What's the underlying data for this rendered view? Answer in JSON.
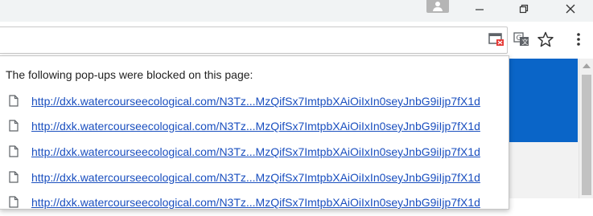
{
  "window": {
    "title": "",
    "controls": {
      "minimize": "–",
      "restore": "❐",
      "close": "✕"
    }
  },
  "toolbar": {
    "icons": [
      "popup-blocked-icon",
      "translate-icon",
      "star-icon",
      "menu-icon"
    ]
  },
  "popup_bubble": {
    "title": "The following pop-ups were blocked on this page:",
    "links": [
      "http://dxk.watercourseecological.com/N3Tz...MzQifSx7ImtpbXAiOiIxIn0seyJnbG9iIjp7fX1d",
      "http://dxk.watercourseecological.com/N3Tz...MzQifSx7ImtpbXAiOiIxIn0seyJnbG9iIjp7fX1d",
      "http://dxk.watercourseecological.com/N3Tz...MzQifSx7ImtpbXAiOiIxIn0seyJnbG9iIjp7fX1d",
      "http://dxk.watercourseecological.com/N3Tz...MzQifSx7ImtpbXAiOiIxIn0seyJnbG9iIjp7fX1d",
      "http://dxk.watercourseecological.com/N3Tz...MzQifSx7ImtpbXAiOiIxIn0seyJnbG9iIjp7fX1d"
    ]
  },
  "colors": {
    "link": "#1a4fbf",
    "page_accent": "#0a65c8",
    "blocked_badge": "#e53935"
  }
}
